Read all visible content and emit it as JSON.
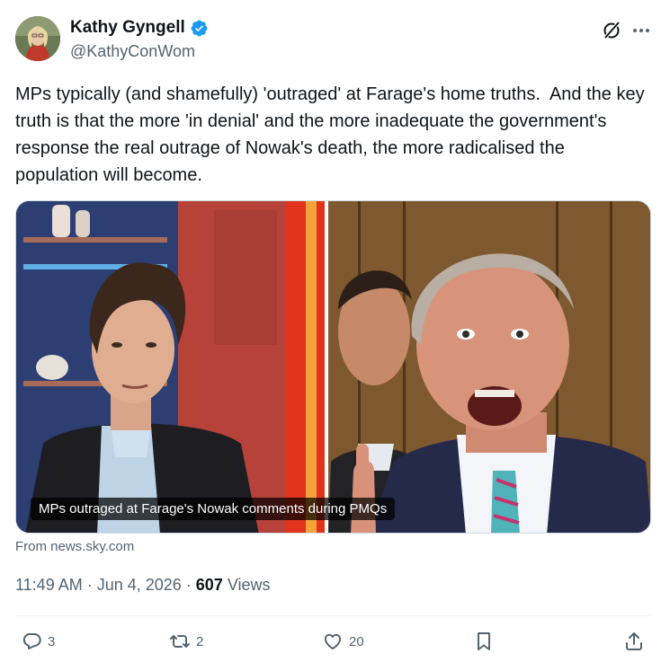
{
  "author": {
    "display_name": "Kathy Gyngell",
    "handle": "@KathyConWom",
    "verified": true
  },
  "tweet": {
    "text": "MPs typically (and shamefully) 'outraged' at Farage's home truths.  And the key truth is that the more 'in denial' and the more inadequate the government's response the real outrage of Nowak's death, the more radicalised the population will become."
  },
  "media": {
    "caption": "MPs outraged at Farage's Nowak comments during PMQs",
    "source": "From news.sky.com"
  },
  "meta": {
    "time": "11:49 AM",
    "separator": "·",
    "date": "Jun 4, 2026",
    "views_count": "607",
    "views_label": "Views"
  },
  "actions": {
    "reply_count": "3",
    "repost_count": "2",
    "like_count": "20"
  },
  "colors": {
    "text": "#0f1419",
    "secondary": "#536471",
    "verified": "#1d9bf0",
    "divider": "#eff3f4"
  },
  "icons": [
    "grok-icon",
    "more-icon",
    "reply-icon",
    "repost-icon",
    "like-icon",
    "bookmark-icon",
    "share-icon",
    "verified-badge-icon"
  ]
}
